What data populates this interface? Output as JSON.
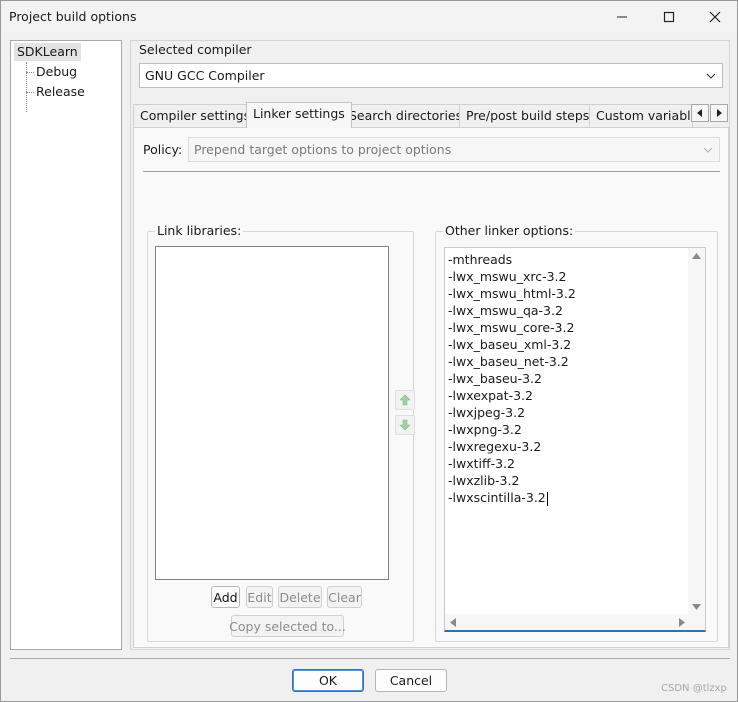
{
  "window": {
    "title": "Project build options"
  },
  "tree": {
    "root": "SDKLearn",
    "children": [
      "Debug",
      "Release"
    ]
  },
  "compiler": {
    "label": "Selected compiler",
    "value": "GNU GCC Compiler"
  },
  "tabs": [
    {
      "label": "Compiler settings",
      "active": false
    },
    {
      "label": "Linker settings",
      "active": true
    },
    {
      "label": "Search directories",
      "active": false
    },
    {
      "label": "Pre/post build steps",
      "active": false
    },
    {
      "label": "Custom variable",
      "active": false
    }
  ],
  "policy": {
    "label": "Policy:",
    "value": "Prepend target options to project options"
  },
  "link_libraries": {
    "label": "Link libraries:",
    "items": [],
    "buttons": {
      "add": "Add",
      "edit": "Edit",
      "delete": "Delete",
      "clear": "Clear",
      "copy_selected": "Copy selected to..."
    }
  },
  "other_linker_options": {
    "label": "Other linker options:",
    "lines": [
      "-mthreads",
      "-lwx_mswu_xrc-3.2",
      "-lwx_mswu_html-3.2",
      "-lwx_mswu_qa-3.2",
      "-lwx_mswu_core-3.2",
      "-lwx_baseu_xml-3.2",
      "-lwx_baseu_net-3.2",
      "-lwx_baseu-3.2",
      "-lwxexpat-3.2",
      "-lwxjpeg-3.2",
      "-lwxpng-3.2",
      "-lwxregexu-3.2",
      "-lwxtiff-3.2",
      "-lwxzlib-3.2",
      "-lwxscintilla-3.2"
    ]
  },
  "dialog_buttons": {
    "ok": "OK",
    "cancel": "Cancel"
  },
  "watermark": "CSDN @tlzxp",
  "colors": {
    "focus_accent": "#2f6fb5",
    "disabled_arrow": "#9fd19f"
  }
}
